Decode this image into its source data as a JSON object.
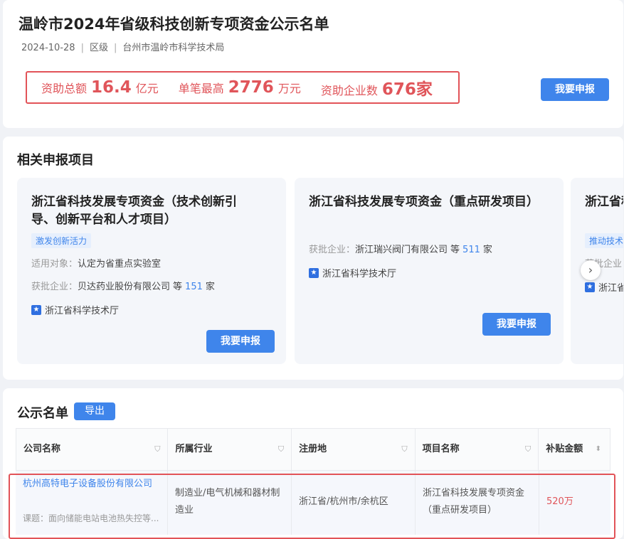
{
  "header": {
    "title": "温岭市2024年省级科技创新专项资金公示名单",
    "date": "2024-10-28",
    "level": "区级",
    "publisher": "台州市温岭市科学技术局",
    "stats": [
      {
        "label": "资助总额",
        "value": "16.4",
        "unit": "亿元"
      },
      {
        "label": "单笔最高",
        "value": "2776",
        "unit": "万元"
      },
      {
        "label": "资助企业数",
        "value": "676家",
        "unit": ""
      }
    ],
    "apply_label": "我要申报",
    "accent_color": "#3f85eb",
    "highlight_color": "#e0555a"
  },
  "related": {
    "title": "相关申报项目",
    "cards": [
      {
        "title": "浙江省科技发展专项资金（技术创新引导、创新平台和人才项目）",
        "tag": "激发创新活力",
        "target_label": "适用对象：",
        "target_value": "认定为省重点实验室",
        "approved_label": "获批企业：",
        "approved_company": "贝达药业股份有限公司",
        "approved_mid": "等",
        "approved_count": "151",
        "approved_unit": "家",
        "org": "浙江省科学技术厅",
        "button": "我要申报"
      },
      {
        "title": "浙江省科技发展专项资金（重点研发项目）",
        "approved_label": "获批企业：",
        "approved_company": "浙江瑞兴阀门有限公司",
        "approved_mid": "等",
        "approved_count": "511",
        "approved_unit": "家",
        "org": "浙江省科学技术厅",
        "button": "我要申报"
      },
      {
        "title": "浙江省科技发展专项资金",
        "tag": "推动技术",
        "approved_label": "获批企业：",
        "org": "浙江省科学技术厅"
      }
    ],
    "next_icon": "chevron-right-icon"
  },
  "public_list": {
    "title": "公示名单",
    "export_label": "导出",
    "columns": [
      "公司名称",
      "所属行业",
      "注册地",
      "项目名称",
      "补贴金额"
    ],
    "rows": [
      {
        "company": "杭州高特电子设备股份有限公司",
        "subject": "课题：面向储能电站电池热失控等...",
        "industry": "制造业/电气机械和器材制造业",
        "location": "浙江省/杭州市/余杭区",
        "project": "浙江省科技发展专项资金（重点研发项目）",
        "amount": "520万"
      }
    ]
  }
}
